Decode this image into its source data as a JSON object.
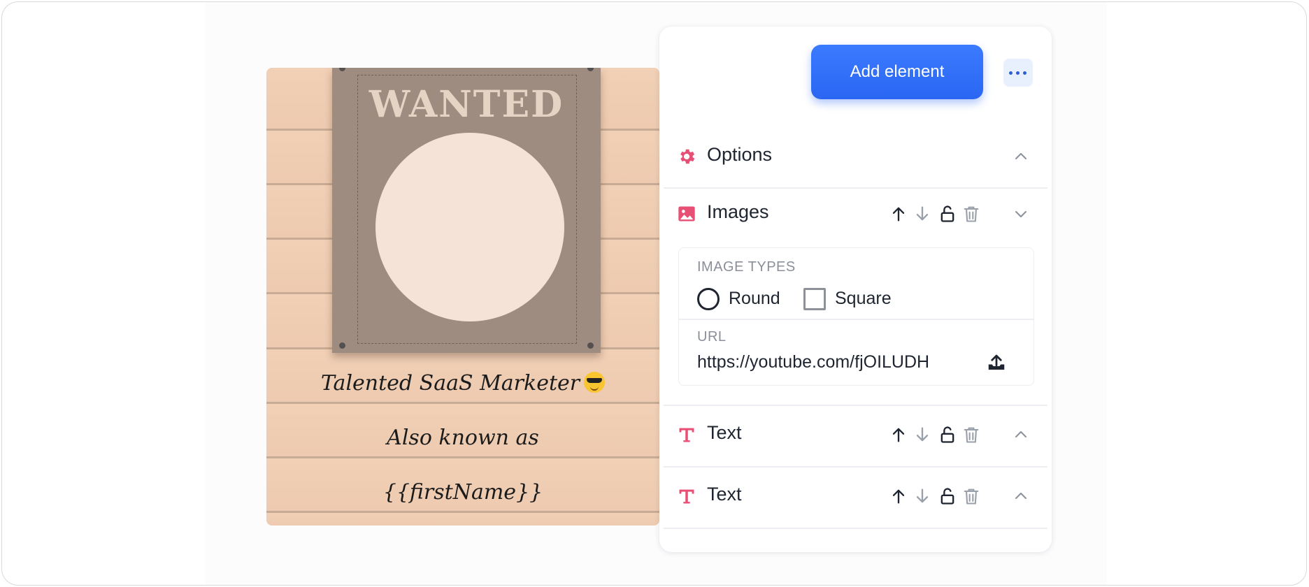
{
  "canvas": {
    "poster_title": "WANTED",
    "line1": "Talented SaaS Marketer",
    "line2": "Also known as",
    "line3": "{{firstName}}"
  },
  "panel": {
    "add_element_label": "Add element",
    "sections": {
      "options": {
        "title": "Options"
      },
      "images": {
        "title": "Images"
      },
      "text1": {
        "title": "Text"
      },
      "text2": {
        "title": "Text"
      }
    },
    "image_types": {
      "label": "IMAGE TYPES",
      "options": [
        "Round",
        "Square"
      ],
      "selected": "Round"
    },
    "url": {
      "label": "URL",
      "value": "https://youtube.com/fjOILUDH"
    }
  },
  "colors": {
    "accent": "#2d6cf6",
    "section_icon": "#e84f75",
    "canvas_bg": "#f2d1b8",
    "poster": "#9e8c80"
  },
  "icons": {
    "options": "gear-icon",
    "images": "image-icon",
    "text": "text-t-icon",
    "move_up": "arrow-up-icon",
    "move_down": "arrow-down-icon",
    "lock": "unlock-icon",
    "delete": "trash-icon",
    "upload": "upload-icon",
    "more": "ellipsis-icon"
  }
}
